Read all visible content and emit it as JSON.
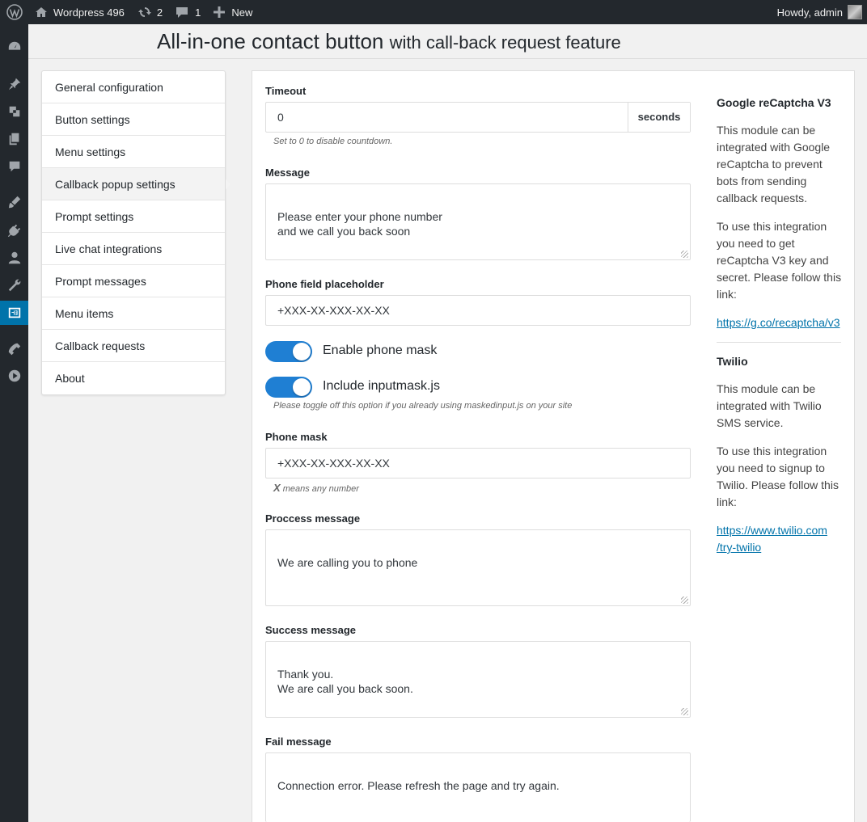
{
  "adminbar": {
    "site_name": "Wordpress 496",
    "updates_count": "2",
    "comments_count": "1",
    "new_label": "New",
    "howdy": "Howdy, admin"
  },
  "page": {
    "title_main": "All-in-one contact button",
    "title_sub": "with call-back request feature"
  },
  "tabs": [
    "General configuration",
    "Button settings",
    "Menu settings",
    "Callback popup settings",
    "Prompt settings",
    "Live chat integrations",
    "Prompt messages",
    "Menu items",
    "Callback requests",
    "About"
  ],
  "active_tab": "Callback popup settings",
  "form": {
    "timeout": {
      "label": "Timeout",
      "value": "0",
      "addon": "seconds",
      "hint": "Set to 0 to disable countdown."
    },
    "message": {
      "label": "Message",
      "value": "Please enter your phone number\nand we call you back soon"
    },
    "phone_placeholder": {
      "label": "Phone field placeholder",
      "value": "+XXX-XX-XXX-XX-XX"
    },
    "enable_mask": {
      "label": "Enable phone mask",
      "on": true
    },
    "include_inputmask": {
      "label": "Include inputmask.js",
      "on": true,
      "hint": "Please toggle off this option if you already using maskedinput.js on your site"
    },
    "phone_mask": {
      "label": "Phone mask",
      "value": "+XXX-XX-XXX-XX-XX",
      "hint_x": "X",
      "hint_rest": " means any number"
    },
    "process_message": {
      "label": "Proccess message",
      "value": "We are calling you to phone"
    },
    "success_message": {
      "label": "Success message",
      "value": "Thank you.\nWe are call you back soon."
    },
    "fail_message": {
      "label": "Fail message",
      "value": "Connection error. Please refresh the page and try again."
    }
  },
  "sidebar": {
    "recaptcha": {
      "title": "Google reCaptcha V3",
      "p1": "This module can be integrated with Google reCaptcha to prevent bots from sending callback requests.",
      "p2": "To use this integration you need to get reCaptcha V3 key and secret. Please follow this link:",
      "link": "https://g.co/recaptcha/v3"
    },
    "twilio": {
      "title": "Twilio",
      "p1": "This module can be integrated with Twilio SMS service.",
      "p2": "To use this integration you need to signup to Twilio. Please follow this link:",
      "link_line1": "https://www.twilio.com",
      "link_line2": "/try-twilio"
    }
  },
  "colors": {
    "accent": "#0073aa",
    "toggle_on": "#1f7fd3",
    "adminbar": "#23282d"
  }
}
